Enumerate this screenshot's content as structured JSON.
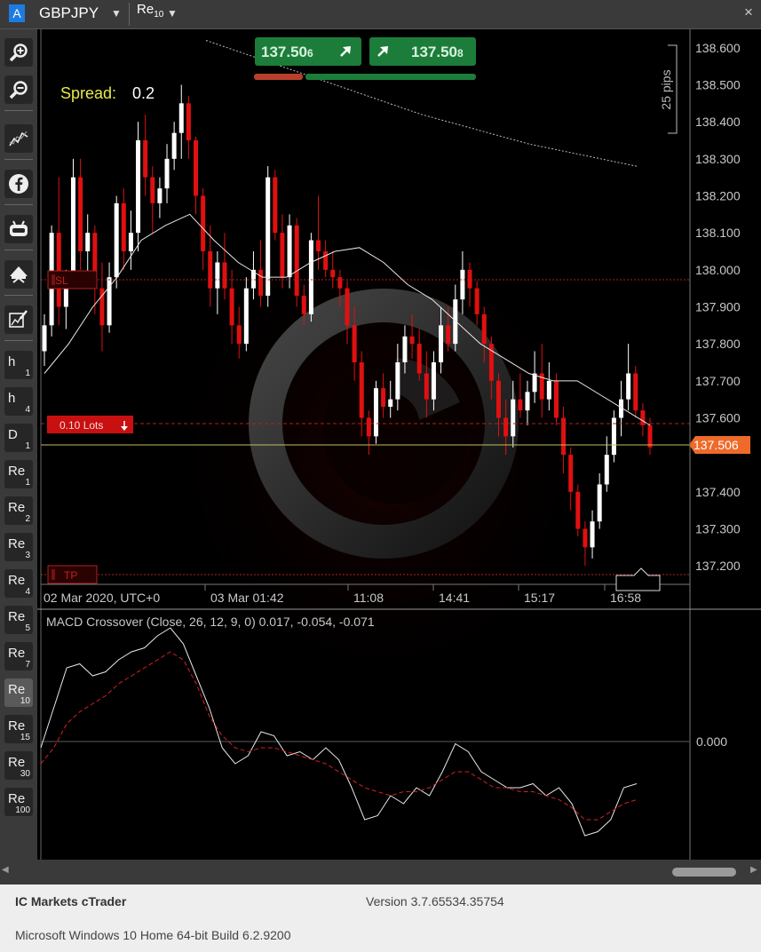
{
  "window": {
    "account_badge": "A",
    "symbol": "GBPJPY",
    "timeframe": {
      "main": "Re",
      "sub": "10"
    },
    "dropdown_glyph": "▼",
    "close_glyph": "×"
  },
  "sidebar": {
    "tool_icons": [
      "zoom-in-icon",
      "zoom-out-icon",
      "indicator-icon",
      "facebook-icon",
      "robot-icon",
      "pattern-icon",
      "drawing-icon"
    ],
    "timeframes": [
      {
        "main": "h",
        "sub": "1",
        "active": false
      },
      {
        "main": "h",
        "sub": "4",
        "active": false
      },
      {
        "main": "D",
        "sub": "1",
        "active": false
      },
      {
        "main": "Re",
        "sub": "1",
        "active": false
      },
      {
        "main": "Re",
        "sub": "2",
        "active": false
      },
      {
        "main": "Re",
        "sub": "3",
        "active": false
      },
      {
        "main": "Re",
        "sub": "4",
        "active": false
      },
      {
        "main": "Re",
        "sub": "5",
        "active": false
      },
      {
        "main": "Re",
        "sub": "7",
        "active": false
      },
      {
        "main": "Re",
        "sub": "10",
        "active": true
      },
      {
        "main": "Re",
        "sub": "15",
        "active": false
      },
      {
        "main": "Re",
        "sub": "30",
        "active": false
      },
      {
        "main": "Re",
        "sub": "100",
        "active": false
      }
    ]
  },
  "quickTrade": {
    "sell": {
      "price": "137.50",
      "pip": "6"
    },
    "buy": {
      "price": "137.50",
      "pip": "8"
    }
  },
  "spread": {
    "label": "Spread:",
    "value": "0.2"
  },
  "scale_label": "25 pips",
  "levels": {
    "sl": "SL",
    "tp": "TP",
    "lots": "0.10 Lots",
    "current_price": "137.506"
  },
  "colors": {
    "bull": "#ffffff",
    "bear": "#e01010",
    "current_price_tag": "#ee6a2a",
    "sell_button": "#1c7d3a",
    "buy_button": "#1c7d3a",
    "spread_label": "#e8e84a",
    "macd_signal": "#d42020",
    "level_line": "#b02020"
  },
  "macd": {
    "title": "MACD Crossover (Close, 26, 12, 9, 0) 0.017, -0.054, -0.071"
  },
  "footer": {
    "app": "IC Markets cTrader",
    "version": "Version 3.7.65534.35754",
    "os": "Microsoft Windows 10 Home 64-bit Build 6.2.9200"
  },
  "chart_data": [
    {
      "type": "candlestick",
      "title": "GBPJPY",
      "x_tick_labels": [
        "02 Mar 2020, UTC+0",
        "03 Mar 01:42",
        "11:08",
        "14:41",
        "15:17",
        "16:58"
      ],
      "y_tick_labels": [
        "138.600",
        "138.500",
        "138.400",
        "138.300",
        "138.200",
        "138.100",
        "138.000",
        "137.900",
        "137.800",
        "137.700",
        "137.600",
        "137.400",
        "137.300",
        "137.200"
      ],
      "ylim": [
        137.15,
        138.65
      ],
      "levels": {
        "stop_loss": 137.975,
        "take_profit": 137.155,
        "entry": 137.57,
        "current": 137.506
      },
      "candles": [
        {
          "o": 137.78,
          "h": 137.88,
          "l": 137.74,
          "c": 137.85
        },
        {
          "o": 137.85,
          "h": 138.12,
          "l": 137.82,
          "c": 138.1
        },
        {
          "o": 138.1,
          "h": 138.25,
          "l": 137.85,
          "c": 137.9
        },
        {
          "o": 137.9,
          "h": 138.0,
          "l": 137.84,
          "c": 137.97
        },
        {
          "o": 137.97,
          "h": 138.3,
          "l": 137.95,
          "c": 138.25
        },
        {
          "o": 138.25,
          "h": 138.3,
          "l": 138.0,
          "c": 138.05
        },
        {
          "o": 138.05,
          "h": 138.15,
          "l": 137.95,
          "c": 138.1
        },
        {
          "o": 138.1,
          "h": 138.12,
          "l": 137.88,
          "c": 137.95
        },
        {
          "o": 137.95,
          "h": 138.02,
          "l": 137.78,
          "c": 137.85
        },
        {
          "o": 137.85,
          "h": 138.02,
          "l": 137.83,
          "c": 137.98
        },
        {
          "o": 137.98,
          "h": 138.2,
          "l": 137.95,
          "c": 138.18
        },
        {
          "o": 138.18,
          "h": 138.22,
          "l": 138.0,
          "c": 138.05
        },
        {
          "o": 138.05,
          "h": 138.16,
          "l": 138.0,
          "c": 138.1
        },
        {
          "o": 138.1,
          "h": 138.4,
          "l": 138.05,
          "c": 138.35
        },
        {
          "o": 138.35,
          "h": 138.42,
          "l": 138.2,
          "c": 138.25
        },
        {
          "o": 138.25,
          "h": 138.28,
          "l": 138.1,
          "c": 138.18
        },
        {
          "o": 138.18,
          "h": 138.25,
          "l": 138.14,
          "c": 138.22
        },
        {
          "o": 138.22,
          "h": 138.34,
          "l": 138.18,
          "c": 138.3
        },
        {
          "o": 138.3,
          "h": 138.4,
          "l": 138.27,
          "c": 138.37
        },
        {
          "o": 138.37,
          "h": 138.5,
          "l": 138.3,
          "c": 138.45
        },
        {
          "o": 138.45,
          "h": 138.47,
          "l": 138.3,
          "c": 138.35
        },
        {
          "o": 138.35,
          "h": 138.36,
          "l": 138.15,
          "c": 138.2
        },
        {
          "o": 138.2,
          "h": 138.22,
          "l": 138.0,
          "c": 138.05
        },
        {
          "o": 138.05,
          "h": 138.12,
          "l": 137.9,
          "c": 137.95
        },
        {
          "o": 137.95,
          "h": 138.05,
          "l": 137.88,
          "c": 138.02
        },
        {
          "o": 138.02,
          "h": 138.1,
          "l": 137.92,
          "c": 137.95
        },
        {
          "o": 137.95,
          "h": 138.0,
          "l": 137.8,
          "c": 137.85
        },
        {
          "o": 137.85,
          "h": 137.9,
          "l": 137.76,
          "c": 137.8
        },
        {
          "o": 137.8,
          "h": 137.98,
          "l": 137.78,
          "c": 137.95
        },
        {
          "o": 137.95,
          "h": 138.05,
          "l": 137.92,
          "c": 138.0
        },
        {
          "o": 138.0,
          "h": 138.08,
          "l": 137.9,
          "c": 137.93
        },
        {
          "o": 137.93,
          "h": 138.28,
          "l": 137.9,
          "c": 138.25
        },
        {
          "o": 138.25,
          "h": 138.27,
          "l": 138.08,
          "c": 138.1
        },
        {
          "o": 138.1,
          "h": 138.15,
          "l": 137.95,
          "c": 137.98
        },
        {
          "o": 137.98,
          "h": 138.15,
          "l": 137.95,
          "c": 138.12
        },
        {
          "o": 138.12,
          "h": 138.14,
          "l": 137.9,
          "c": 137.93
        },
        {
          "o": 137.93,
          "h": 137.96,
          "l": 137.85,
          "c": 137.88
        },
        {
          "o": 137.88,
          "h": 138.1,
          "l": 137.86,
          "c": 138.08
        },
        {
          "o": 138.08,
          "h": 138.2,
          "l": 138.0,
          "c": 138.05
        },
        {
          "o": 138.05,
          "h": 138.08,
          "l": 137.98,
          "c": 138.0
        },
        {
          "o": 138.0,
          "h": 138.05,
          "l": 137.95,
          "c": 137.98
        },
        {
          "o": 137.98,
          "h": 138.0,
          "l": 137.9,
          "c": 137.95
        },
        {
          "o": 137.95,
          "h": 137.97,
          "l": 137.8,
          "c": 137.85
        },
        {
          "o": 137.85,
          "h": 137.9,
          "l": 137.7,
          "c": 137.75
        },
        {
          "o": 137.75,
          "h": 137.78,
          "l": 137.55,
          "c": 137.6
        },
        {
          "o": 137.6,
          "h": 137.62,
          "l": 137.5,
          "c": 137.55
        },
        {
          "o": 137.55,
          "h": 137.7,
          "l": 137.53,
          "c": 137.68
        },
        {
          "o": 137.68,
          "h": 137.72,
          "l": 137.6,
          "c": 137.63
        },
        {
          "o": 137.63,
          "h": 137.7,
          "l": 137.6,
          "c": 137.65
        },
        {
          "o": 137.65,
          "h": 137.8,
          "l": 137.62,
          "c": 137.75
        },
        {
          "o": 137.75,
          "h": 137.85,
          "l": 137.72,
          "c": 137.82
        },
        {
          "o": 137.82,
          "h": 137.88,
          "l": 137.76,
          "c": 137.8
        },
        {
          "o": 137.8,
          "h": 137.84,
          "l": 137.7,
          "c": 137.72
        },
        {
          "o": 137.72,
          "h": 137.78,
          "l": 137.6,
          "c": 137.65
        },
        {
          "o": 137.65,
          "h": 137.78,
          "l": 137.62,
          "c": 137.75
        },
        {
          "o": 137.75,
          "h": 137.9,
          "l": 137.72,
          "c": 137.85
        },
        {
          "o": 137.85,
          "h": 137.9,
          "l": 137.78,
          "c": 137.8
        },
        {
          "o": 137.8,
          "h": 137.96,
          "l": 137.78,
          "c": 137.92
        },
        {
          "o": 137.92,
          "h": 138.05,
          "l": 137.88,
          "c": 138.0
        },
        {
          "o": 138.0,
          "h": 138.02,
          "l": 137.9,
          "c": 137.95
        },
        {
          "o": 137.95,
          "h": 137.97,
          "l": 137.85,
          "c": 137.88
        },
        {
          "o": 137.88,
          "h": 137.9,
          "l": 137.75,
          "c": 137.8
        },
        {
          "o": 137.8,
          "h": 137.82,
          "l": 137.65,
          "c": 137.7
        },
        {
          "o": 137.7,
          "h": 137.72,
          "l": 137.55,
          "c": 137.6
        },
        {
          "o": 137.6,
          "h": 137.65,
          "l": 137.5,
          "c": 137.55
        },
        {
          "o": 137.55,
          "h": 137.7,
          "l": 137.52,
          "c": 137.65
        },
        {
          "o": 137.65,
          "h": 137.72,
          "l": 137.6,
          "c": 137.62
        },
        {
          "o": 137.62,
          "h": 137.7,
          "l": 137.58,
          "c": 137.67
        },
        {
          "o": 137.67,
          "h": 137.78,
          "l": 137.64,
          "c": 137.72
        },
        {
          "o": 137.72,
          "h": 137.8,
          "l": 137.6,
          "c": 137.65
        },
        {
          "o": 137.65,
          "h": 137.75,
          "l": 137.62,
          "c": 137.7
        },
        {
          "o": 137.7,
          "h": 137.72,
          "l": 137.58,
          "c": 137.6
        },
        {
          "o": 137.6,
          "h": 137.63,
          "l": 137.45,
          "c": 137.5
        },
        {
          "o": 137.5,
          "h": 137.52,
          "l": 137.35,
          "c": 137.4
        },
        {
          "o": 137.4,
          "h": 137.42,
          "l": 137.28,
          "c": 137.3
        },
        {
          "o": 137.3,
          "h": 137.32,
          "l": 137.2,
          "c": 137.25
        },
        {
          "o": 137.25,
          "h": 137.35,
          "l": 137.22,
          "c": 137.32
        },
        {
          "o": 137.32,
          "h": 137.45,
          "l": 137.3,
          "c": 137.42
        },
        {
          "o": 137.42,
          "h": 137.55,
          "l": 137.4,
          "c": 137.5
        },
        {
          "o": 137.5,
          "h": 137.62,
          "l": 137.48,
          "c": 137.6
        },
        {
          "o": 137.6,
          "h": 137.7,
          "l": 137.55,
          "c": 137.65
        },
        {
          "o": 137.65,
          "h": 137.8,
          "l": 137.62,
          "c": 137.72
        },
        {
          "o": 137.72,
          "h": 137.74,
          "l": 137.6,
          "c": 137.62
        },
        {
          "o": 137.62,
          "h": 137.64,
          "l": 137.55,
          "c": 137.58
        },
        {
          "o": 137.58,
          "h": 137.6,
          "l": 137.5,
          "c": 137.52
        }
      ],
      "ma_upper": [
        138.62,
        138.52,
        138.42,
        138.34,
        138.28
      ],
      "ma_fast": [
        137.72,
        137.8,
        137.9,
        137.98,
        138.08,
        138.12,
        138.15,
        138.08,
        138.02,
        137.98,
        137.98,
        138.02,
        138.05,
        138.06,
        138.02,
        137.96,
        137.92,
        137.86,
        137.8,
        137.76,
        137.72,
        137.7,
        137.7,
        137.66,
        137.62,
        137.58
      ]
    },
    {
      "type": "line",
      "title": "MACD Crossover (Close, 26, 12, 9, 0) 0.017, -0.054, -0.071",
      "y_tick_labels": [
        "0.000"
      ],
      "ylim": [
        -0.28,
        0.32
      ],
      "series": [
        {
          "values": [
            0.0,
            0.1,
            0.2,
            0.21,
            0.18,
            0.19,
            0.22,
            0.24,
            0.25,
            0.28,
            0.3,
            0.26,
            0.18,
            0.1,
            0.0,
            -0.04,
            -0.02,
            0.04,
            0.03,
            -0.02,
            -0.01,
            -0.03,
            0.0,
            -0.03,
            -0.1,
            -0.18,
            -0.17,
            -0.12,
            -0.14,
            -0.1,
            -0.12,
            -0.06,
            0.01,
            -0.01,
            -0.06,
            -0.08,
            -0.1,
            -0.1,
            -0.09,
            -0.12,
            -0.1,
            -0.14,
            -0.22,
            -0.21,
            -0.18,
            -0.1,
            -0.09
          ]
        },
        {
          "values": [
            -0.04,
            0.0,
            0.06,
            0.09,
            0.11,
            0.13,
            0.16,
            0.18,
            0.2,
            0.22,
            0.24,
            0.22,
            0.16,
            0.08,
            0.03,
            0.0,
            -0.01,
            0.0,
            0.0,
            -0.01,
            -0.02,
            -0.03,
            -0.04,
            -0.06,
            -0.08,
            -0.1,
            -0.11,
            -0.12,
            -0.11,
            -0.11,
            -0.1,
            -0.08,
            -0.06,
            -0.06,
            -0.08,
            -0.1,
            -0.1,
            -0.11,
            -0.11,
            -0.12,
            -0.13,
            -0.15,
            -0.18,
            -0.18,
            -0.16,
            -0.14,
            -0.13
          ]
        }
      ]
    }
  ]
}
